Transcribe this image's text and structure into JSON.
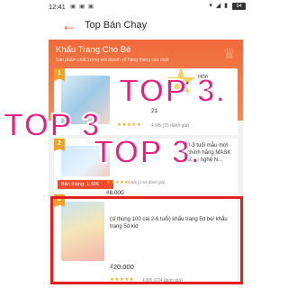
{
  "status_bar": {
    "time": "12:41",
    "left_icons": "▣ ▣ ▣",
    "right_icons": "▾ ◢ ▮",
    "battery": "94"
  },
  "header": {
    "title": "Top Bán Chạy",
    "back_icon": "back-arrow-icon"
  },
  "banner": {
    "title": "Khẩu Trang Cho Bé",
    "subtitle": "Sản phẩm chất lượng với doanh số hàng tháng cao nhất"
  },
  "products": [
    {
      "rank": "1",
      "name": "Hộp",
      "price": "21",
      "stars": "★★★★★",
      "rating": "4.9/5 (75 đánh giá)"
    },
    {
      "rank": "2",
      "name": "0-3 tuổi mẫu mới chính hãng MASK công nghệ N...",
      "sold": "Bán tháng: 1,496",
      "price": "₫8.000",
      "stars": "★★★★★",
      "rating": "4.9/5 (1,64 đánh giá)"
    },
    {
      "rank": "3",
      "name": "(sỉ thùng 100 cái 2-6 tuổi) khẩu trang 5d bé/ khẩu trang 5d kid",
      "price": "₫20.000",
      "stars": "★★★★★",
      "rating": "4.8/5 (224 đánh giá)"
    }
  ],
  "overlay_texts": [
    "TOP 3.",
    "TOP 3",
    "TOP 3."
  ],
  "colors": {
    "accent": "#ee4d2d",
    "overlay": "#ea1c7c",
    "highlight_border": "#e02020"
  }
}
